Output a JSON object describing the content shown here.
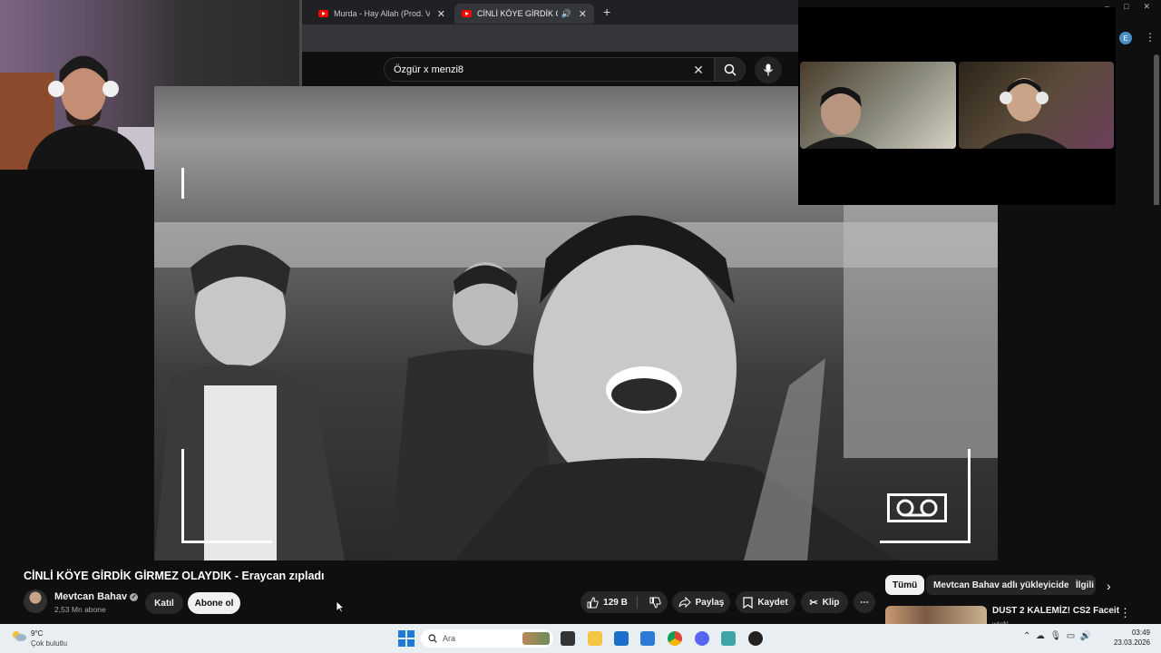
{
  "browser": {
    "tabs": [
      {
        "label": "Murda - Hay Allah (Prod. Vlado"
      },
      {
        "label": "CİNLİ KÖYE GİRDİK GİRMEZ"
      }
    ],
    "new_tab": "+",
    "tab_close": "✕",
    "window_controls": [
      "–",
      "□",
      "✕"
    ],
    "profile_letter": "E"
  },
  "youtube": {
    "search_value": "Özgür x menzi8",
    "video_title": "CİNLİ KÖYE GİRDİK GİRMEZ OLAYDIK - Eraycan zıpladı",
    "channel": {
      "name": "Mevtcan Bahav",
      "subscribers": "2,53 Mn abone",
      "verified": true
    },
    "join_label": "Katıl",
    "subscribe_label": "Abone ol",
    "like_count": "129 B",
    "share_label": "Paylaş",
    "save_label": "Kaydet",
    "clip_label": "Klip",
    "more_label": "⋯",
    "chips": [
      "Tümü",
      "Mevtcan Bahav adlı yükleyiciden",
      "İlgili"
    ],
    "recommendation": {
      "title": "DUST 2 KALEMİZ! CS2 Faceit",
      "channel": "wtcN"
    }
  },
  "taskbar": {
    "temperature": "9°C",
    "condition": "Çok bulutlu",
    "search_placeholder": "Ara",
    "time": "03:49",
    "date": "23.03.2026"
  },
  "colors": {
    "youtube_bg": "#0f0f0f",
    "tab_bg": "#202124",
    "taskbar_bg": "#e9eef3",
    "brand_red": "#ff0000",
    "windows_blue": "#1f78d1"
  },
  "icons": [
    "youtube-icon",
    "search-icon",
    "mic-icon",
    "clear-icon",
    "verified-icon",
    "like-icon",
    "dislike-icon",
    "share-icon",
    "save-icon",
    "clip-icon",
    "windows-start-icon",
    "weather-icon",
    "cassette-icon"
  ]
}
